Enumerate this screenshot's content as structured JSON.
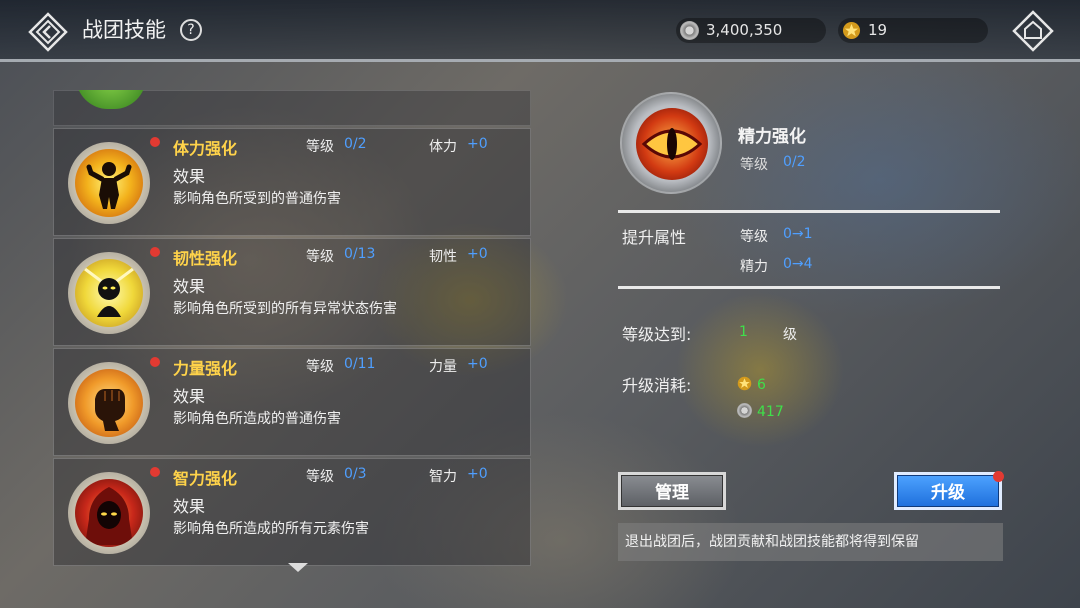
{
  "header": {
    "title": "战团技能",
    "help_icon": "?",
    "currency_coin": "3,400,350",
    "currency_star": "19"
  },
  "skills": [
    {
      "name": "体力强化",
      "level_label": "等级",
      "level": "0/2",
      "attr_label": "体力",
      "attr_value": "+0",
      "effect_label": "效果",
      "description": "影响角色所受到的普通伤害",
      "icon": "strength-figure-icon"
    },
    {
      "name": "韧性强化",
      "level_label": "等级",
      "level": "0/13",
      "attr_label": "韧性",
      "attr_value": "+0",
      "effect_label": "效果",
      "description": "影响角色所受到的所有异常状态伤害",
      "icon": "toughness-figure-icon"
    },
    {
      "name": "力量强化",
      "level_label": "等级",
      "level": "0/11",
      "attr_label": "力量",
      "attr_value": "+0",
      "effect_label": "效果",
      "description": "影响角色所造成的普通伤害",
      "icon": "fist-icon"
    },
    {
      "name": "智力强化",
      "level_label": "等级",
      "level": "0/3",
      "attr_label": "智力",
      "attr_value": "+0",
      "effect_label": "效果",
      "description": "影响角色所造成的所有元素伤害",
      "icon": "hooded-mage-icon"
    }
  ],
  "detail": {
    "name": "精力强化",
    "level_label": "等级",
    "level": "0/2",
    "attr_heading": "提升属性",
    "rows": [
      {
        "label": "等级",
        "value": "0→1"
      },
      {
        "label": "精力",
        "value": "0→4"
      }
    ],
    "requirement_label": "等级达到:",
    "requirement_value": "1",
    "requirement_unit": "级",
    "cost_label": "升级消耗:",
    "cost_star": "6",
    "cost_coin": "417",
    "manage_button": "管理",
    "upgrade_button": "升级",
    "notice": "退出战团后，战团贡献和战团技能都将得到保留"
  },
  "colors": {
    "skill_name": "#ffd34a",
    "value_blue": "#4f9fff",
    "value_green": "#3fe04a",
    "badge_red": "#e23a32"
  }
}
